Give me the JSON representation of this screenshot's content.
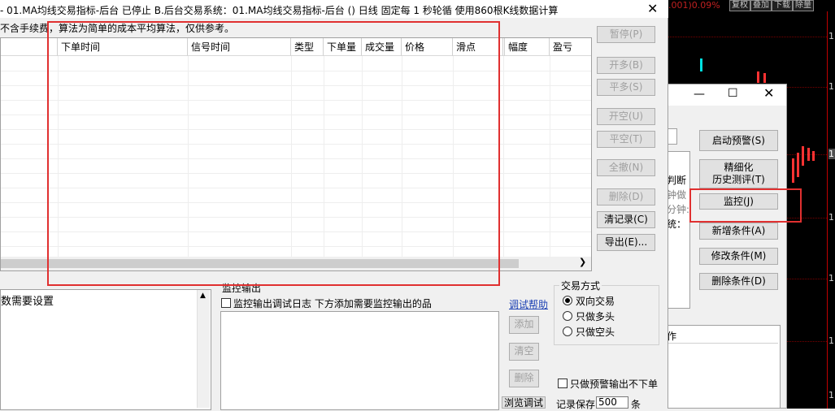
{
  "window": {
    "title": "- 01.MA均线交易指标-后台 已停止  B.后台交易系统：01.MA均线交易指标-后台 () 日线 固定每 1 秒轮循 使用860根K线数据计算",
    "note": "不含手续费，算法为简单的成本平均算法，仅供参考。"
  },
  "table": {
    "columns": [
      "",
      "下单时间",
      "信号时间",
      "类型",
      "下单量",
      "成交量",
      "价格",
      "滑点",
      "",
      "幅度",
      "盈亏"
    ],
    "rows": []
  },
  "side_buttons": {
    "pause": "暂停(P)",
    "open_long": "开多(B)",
    "close_long": "平多(S)",
    "open_short": "开空(U)",
    "close_short": "平空(T)",
    "cancel_all": "全撤(N)",
    "delete": "删除(D)",
    "clear_log": "清记录(C)",
    "export": "导出(E)..."
  },
  "bottom": {
    "params_label": "数需要设置",
    "monitor_group": "监控输出",
    "monitor_debug_label": "监控输出调试日志  下方添加需要监控输出的品",
    "debug_help": "调试帮助",
    "add": "添加",
    "clear": "清空",
    "remove": "删除",
    "browse_debug": "浏览调试",
    "trade_mode_group": "交易方式",
    "trade_modes": [
      "双向交易",
      "只做多头",
      "只做空头"
    ],
    "only_alert": "只做预警输出不下单",
    "keep_records_label": "记录保存",
    "keep_records_value": "500",
    "keep_records_unit": "条"
  },
  "dialog": {
    "start_alert": "启动预警(S)",
    "refine_line1": "精细化",
    "refine_line2": "历史测评(T)",
    "monitor": "监控(J)",
    "add_condition": "新增条件(A)",
    "edit_condition": "修改条件(M)",
    "delete_condition": "删除条件(D)",
    "side_text": [
      "判断",
      "钟做",
      "分钟:",
      "统："
    ],
    "list_header": "作"
  },
  "chart": {
    "top_text": ".001)0.09%",
    "top_buttons": [
      "复权",
      "叠加",
      "下载",
      "除量"
    ],
    "right_labels": [
      "1.",
      "1.",
      "1.",
      "1.",
      "1.",
      "1.",
      "1."
    ],
    "colors": {
      "up": "#ff3232",
      "down": "#00e0e0",
      "highlight": "#e03030"
    }
  }
}
